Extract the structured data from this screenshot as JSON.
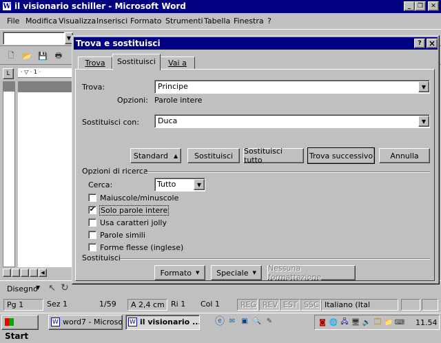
{
  "window": {
    "title": "il visionario schiller - Microsoft Word"
  },
  "menu": [
    "File",
    "Modifica",
    "Visualizza",
    "Inserisci",
    "Formato",
    "Strumenti",
    "Tabella",
    "Finestra",
    "?"
  ],
  "dialog": {
    "title": "Trova e sostituisci",
    "help_btn": "?",
    "close_btn": "×",
    "tabs": [
      "Trova",
      "Sostituisci",
      "Vai a"
    ],
    "find_label": "Trova:",
    "find_value": "Principe",
    "options_label": "Opzioni:",
    "options_value": "Parole intere",
    "replace_label": "Sostituisci con:",
    "replace_value": "Duca",
    "buttons": {
      "standard": "Standard",
      "replace": "Sostituisci",
      "replace_all": "Sostituisci tutto",
      "find_next": "Trova successivo",
      "cancel": "Annulla"
    },
    "search_options_title": "Opzioni di ricerca",
    "search_label": "Cerca:",
    "search_value": "Tutto",
    "checkboxes": [
      {
        "label": "Maiuscole/minuscole",
        "checked": false
      },
      {
        "label": "Solo parole intere",
        "checked": true
      },
      {
        "label": "Usa caratteri jolly",
        "checked": false
      },
      {
        "label": "Parole simili",
        "checked": false
      },
      {
        "label": "Forme flesse (inglese)",
        "checked": false
      }
    ],
    "replace_section_title": "Sostituisci",
    "format_btn": "Formato",
    "special_btn": "Speciale",
    "no_format_btn": "Nessuna formattazione"
  },
  "drawing_toolbar": {
    "label": "Disegno"
  },
  "status": {
    "page": "Pg 1",
    "section": "Sez 1",
    "pages": "1/59",
    "at": "A 2,4 cm",
    "line": "Ri 1",
    "col": "Col 1",
    "rec": "REG",
    "rev": "REV",
    "ext": "EST",
    "ovr": "SSC",
    "language": "Italiano (Ital"
  },
  "taskbar": {
    "start": "Start",
    "tasks": [
      "word7 - Microso...",
      "il visionario ..."
    ],
    "clock": "11.54"
  },
  "colors": {
    "titlebar": "#000080",
    "face": "#c0c0c0",
    "shadow": "#808080"
  }
}
